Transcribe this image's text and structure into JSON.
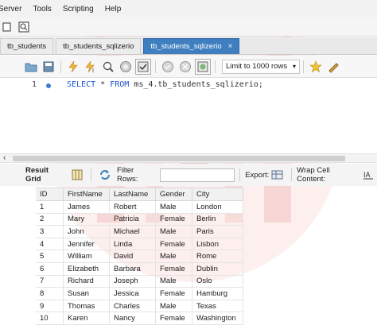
{
  "menubar": {
    "items": [
      "Server",
      "Tools",
      "Scripting",
      "Help"
    ]
  },
  "tabs": [
    {
      "label": "tb_students",
      "active": false
    },
    {
      "label": "tb_students_sqlizerio",
      "active": false
    },
    {
      "label": "tb_students_sqlizerio",
      "active": true
    }
  ],
  "query_toolbar": {
    "limit_label": "Limit to 1000 rows"
  },
  "editor": {
    "line_number": "1",
    "code": {
      "kw1": "SELECT",
      "star": " * ",
      "kw2": "FROM",
      "rest": " ms_4.tb_students_sqlizerio;"
    }
  },
  "result_toolbar": {
    "result_grid": "Result Grid",
    "filter_rows": "Filter Rows:",
    "export": "Export:",
    "wrap_cell": "Wrap Cell Content:"
  },
  "grid": {
    "columns": [
      "ID",
      "FirstName",
      "LastName",
      "Gender",
      "City"
    ],
    "rows": [
      [
        "1",
        "James",
        "Robert",
        "Male",
        "London"
      ],
      [
        "2",
        "Mary",
        "Patricia",
        "Female",
        "Berlin"
      ],
      [
        "3",
        "John",
        "Michael",
        "Male",
        "Paris"
      ],
      [
        "4",
        "Jennifer",
        "Linda",
        "Female",
        "Lisbon"
      ],
      [
        "5",
        "William",
        "David",
        "Male",
        "Rome"
      ],
      [
        "6",
        "Elizabeth",
        "Barbara",
        "Female",
        "Dublin"
      ],
      [
        "7",
        "Richard",
        "Joseph",
        "Male",
        "Oslo"
      ],
      [
        "8",
        "Susan",
        "Jessica",
        "Female",
        "Hamburg"
      ],
      [
        "9",
        "Thomas",
        "Charles",
        "Male",
        "Texas"
      ],
      [
        "10",
        "Karen",
        "Nancy",
        "Female",
        "Washington"
      ]
    ]
  },
  "colors": {
    "active_tab": "#3f7fc0",
    "keyword": "#1e54c9",
    "watermark": "#e57373"
  }
}
